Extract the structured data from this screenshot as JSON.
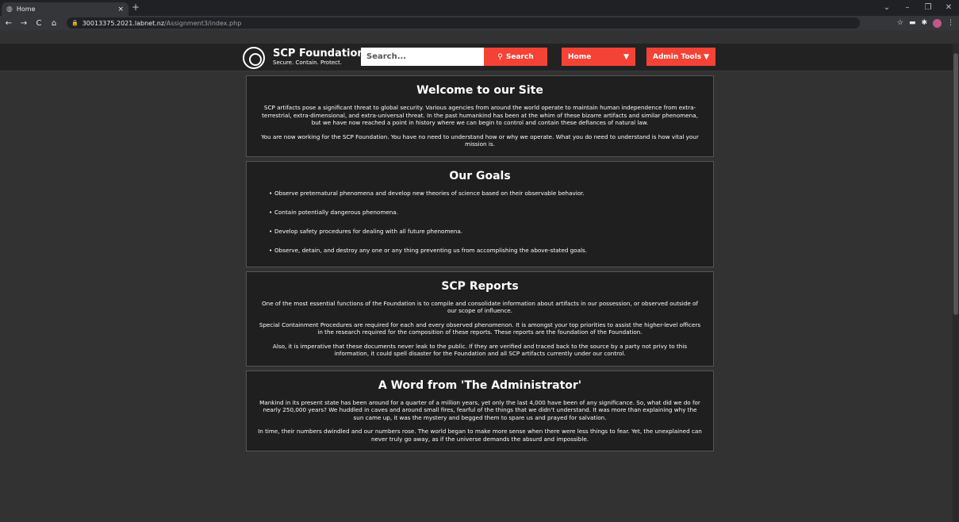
{
  "browser": {
    "tab_title": "Home",
    "tab_close": "×",
    "new_tab": "+",
    "url_host": "30013375.2021.labnet.nz",
    "url_path": "/Assignment3/index.php",
    "icons": [
      "globe-icon",
      "back-icon",
      "forward-icon",
      "reload-icon",
      "home-icon",
      "lock-icon",
      "star-icon",
      "puzzle-icon"
    ]
  },
  "site": {
    "brand_name": "SCP Foundation",
    "brand_tagline": "Secure. Contain. Protect.",
    "search_placeholder": "Search...",
    "search_button": "Search",
    "nav_home": "Home",
    "nav_admin": "Admin Tools",
    "accent_color": "#f44336"
  },
  "sections": {
    "welcome": {
      "title": "Welcome to our Site",
      "p1": "SCP artifacts pose a significant threat to global security. Various agencies from around the world operate to maintain human independence from extra-terrestrial, extra-dimensional, and extra-universal threat. In the past humankind has been at the whim of these bizarre artifacts and similar phenomena, but we have now reached a point in history where we can begin to control and contain these defiances of natural law.",
      "p2": "You are now working for the SCP Foundation. You have no need to understand how or why we operate. What you do need to understand is how vital your mission is."
    },
    "goals": {
      "title": "Our Goals",
      "items": [
        "Observe preternatural phenomena and develop new theories of science based on their observable behavior.",
        "Contain potentially dangerous phenomena.",
        "Develop safety procedures for dealing with all future phenomena.",
        "Observe, detain, and destroy any one or any thing preventing us from accomplishing the above-stated goals."
      ]
    },
    "reports": {
      "title": "SCP Reports",
      "p1": "One of the most essential functions of the Foundation is to compile and consolidate information about artifacts in our possession, or observed outside of our scope of influence.",
      "p2": "Special Containment Procedures are required for each and every observed phenomenon. It is amongst your top priorities to assist the higher-level officers in the research required for the composition of these reports. These reports are the foundation of the Foundation.",
      "p3": "Also, it is imperative that these documents never leak to the public. If they are verified and traced back to the source by a party not privy to this information, it could spell disaster for the Foundation and all SCP artifacts currently under our control."
    },
    "administrator": {
      "title": "A Word from 'The Administrator'",
      "p1": "Mankind in its present state has been around for a quarter of a million years, yet only the last 4,000 have been of any significance. So, what did we do for nearly 250,000 years? We huddled in caves and around small fires, fearful of the things that we didn't understand. It was more than explaining why the sun came up, it was the mystery and begged them to spare us and prayed for salvation.",
      "p2": "In time, their numbers dwindled and our numbers rose. The world began to make more sense when there were less things to fear. Yet, the unexplained can never truly go away, as if the universe demands the absurd and impossible."
    }
  }
}
